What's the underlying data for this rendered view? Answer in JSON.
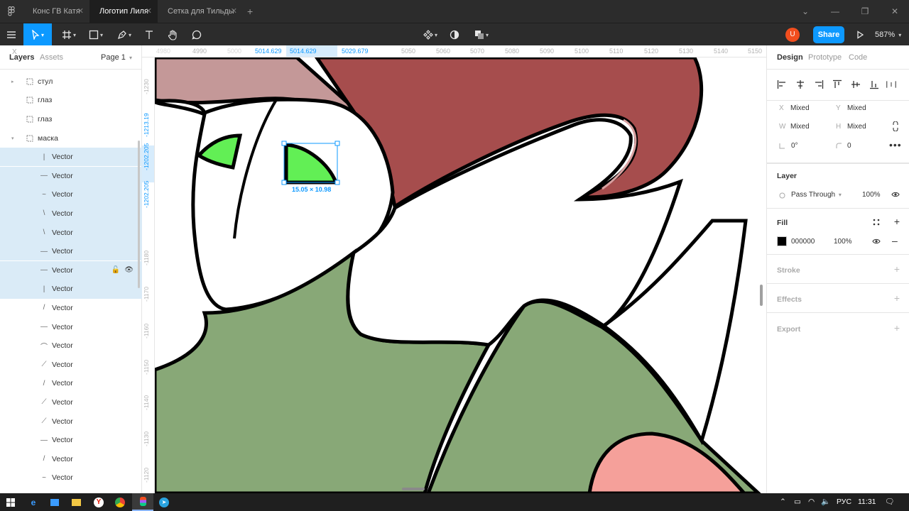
{
  "tabs": [
    {
      "label": "Конс ГВ Катя",
      "active": false
    },
    {
      "label": "Логотип Лиля",
      "active": true
    },
    {
      "label": "Сетка для Тильды",
      "active": false
    }
  ],
  "tab_close_glyph": "✕",
  "new_tab_glyph": "+",
  "window_controls": {
    "chevron": "⌄",
    "minimize": "—",
    "restore": "❐",
    "close": "✕"
  },
  "toolbar": {
    "user_initial": "U",
    "share_label": "Share",
    "zoom_label": "587%",
    "tools": [
      "menu-icon",
      "move-icon",
      "frame-icon",
      "shape-icon",
      "pen-icon",
      "text-icon",
      "hand-icon",
      "comment-icon"
    ],
    "center_tools": [
      "component-icon",
      "mask-icon",
      "boolean-icon"
    ]
  },
  "left_panel": {
    "tabs": [
      "Layers",
      "Assets"
    ],
    "page_label": "Page 1",
    "layers": [
      {
        "label": "стул",
        "icon": "frame-icon",
        "caret": "▸",
        "indent": 0,
        "selected": false
      },
      {
        "label": "глаз",
        "icon": "vector-icon",
        "caret": "",
        "indent": 0,
        "selected": false
      },
      {
        "label": "глаз",
        "icon": "vector-icon",
        "caret": "",
        "indent": 0,
        "selected": false
      },
      {
        "label": "маска",
        "icon": "frame-icon",
        "caret": "▾",
        "indent": 0,
        "selected": false
      },
      {
        "label": "Vector",
        "icon": "line-icon",
        "glyph": "|",
        "indent": 1,
        "selected": true
      },
      {
        "label": "Vector",
        "icon": "line-icon",
        "glyph": "—",
        "indent": 1,
        "selected": true
      },
      {
        "label": "Vector",
        "icon": "line-icon",
        "glyph": "~",
        "indent": 1,
        "selected": true
      },
      {
        "label": "Vector",
        "icon": "line-icon",
        "glyph": "\\",
        "indent": 1,
        "selected": true
      },
      {
        "label": "Vector",
        "icon": "line-icon",
        "glyph": "\\",
        "indent": 1,
        "selected": true
      },
      {
        "label": "Vector",
        "icon": "line-icon",
        "glyph": "—",
        "indent": 1,
        "selected": true
      },
      {
        "label": "Vector",
        "icon": "line-icon",
        "glyph": "—",
        "indent": 1,
        "selected": true,
        "hover": true
      },
      {
        "label": "Vector",
        "icon": "line-icon",
        "glyph": "|",
        "indent": 1,
        "selected": true
      },
      {
        "label": "Vector",
        "icon": "line-icon",
        "glyph": "/",
        "indent": 1,
        "selected": false
      },
      {
        "label": "Vector",
        "icon": "line-icon",
        "glyph": "—",
        "indent": 1,
        "selected": false
      },
      {
        "label": "Vector",
        "icon": "line-icon",
        "glyph": "⌒",
        "indent": 1,
        "selected": false
      },
      {
        "label": "Vector",
        "icon": "line-icon",
        "glyph": "⟋",
        "indent": 1,
        "selected": false
      },
      {
        "label": "Vector",
        "icon": "line-icon",
        "glyph": "/",
        "indent": 1,
        "selected": false
      },
      {
        "label": "Vector",
        "icon": "line-icon",
        "glyph": "⟋",
        "indent": 1,
        "selected": false
      },
      {
        "label": "Vector",
        "icon": "line-icon",
        "glyph": "⟋",
        "indent": 1,
        "selected": false
      },
      {
        "label": "Vector",
        "icon": "line-icon",
        "glyph": "—",
        "indent": 1,
        "selected": false
      },
      {
        "label": "Vector",
        "icon": "line-icon",
        "glyph": "/",
        "indent": 1,
        "selected": false
      },
      {
        "label": "Vector",
        "icon": "line-icon",
        "glyph": "~",
        "indent": 1,
        "selected": false
      }
    ]
  },
  "ruler_top": {
    "ticks": [
      "4980",
      "4990",
      "5000",
      "5014.629",
      "5014.629",
      "5029.679",
      "5050",
      "5060",
      "5070",
      "5080",
      "5090",
      "5100",
      "5110",
      "5120",
      "5130",
      "5140",
      "5150"
    ]
  },
  "ruler_left": {
    "ticks": [
      "-1230",
      "-1213.19",
      "-1202.205",
      "-1202.205",
      "-1180",
      "-1170",
      "-1160",
      "-1150",
      "-1140",
      "-1130",
      "-1120"
    ]
  },
  "canvas": {
    "selection_size": "15.05 × 10.98",
    "help_label": "?",
    "colors": {
      "hair_red": "#a64d4d",
      "hair_pink": "#c49898",
      "eye_green": "#62ef55",
      "body_green": "#88a877",
      "salmon": "#f5a09a",
      "outline": "#000000",
      "selection": "#0d99ff"
    }
  },
  "right_panel": {
    "tabs": [
      "Design",
      "Prototype",
      "Code"
    ],
    "props": {
      "x_label": "X",
      "x_value": "Mixed",
      "y_label": "Y",
      "y_value": "Mixed",
      "w_label": "W",
      "w_value": "Mixed",
      "h_label": "H",
      "h_value": "Mixed",
      "rotation_value": "0°",
      "radius_value": "0"
    },
    "layer": {
      "title": "Layer",
      "blend_mode": "Pass Through",
      "opacity": "100%"
    },
    "fill": {
      "title": "Fill",
      "hex": "000000",
      "opacity": "100%",
      "color": "#000000"
    },
    "sections": [
      "Stroke",
      "Effects",
      "Export"
    ]
  },
  "taskbar": {
    "language": "РУС",
    "time": "11:31"
  }
}
